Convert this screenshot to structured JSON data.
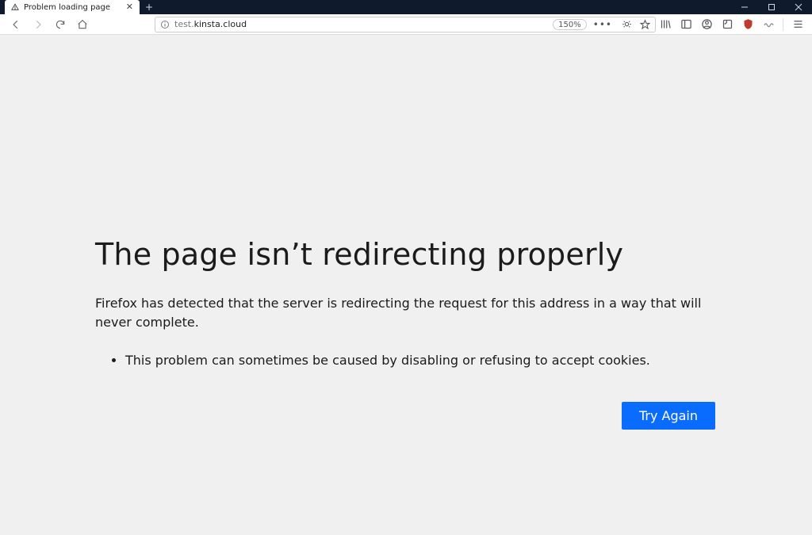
{
  "tab": {
    "title": "Problem loading page"
  },
  "url": {
    "prefix": "test.",
    "host": "kinsta.cloud",
    "zoom": "150%"
  },
  "error": {
    "heading": "The page isn’t redirecting properly",
    "description": "Firefox has detected that the server is redirecting the request for this address in a way that will never complete.",
    "bullet": "This problem can sometimes be caused by disabling or refusing to accept cookies.",
    "button": "Try Again"
  }
}
